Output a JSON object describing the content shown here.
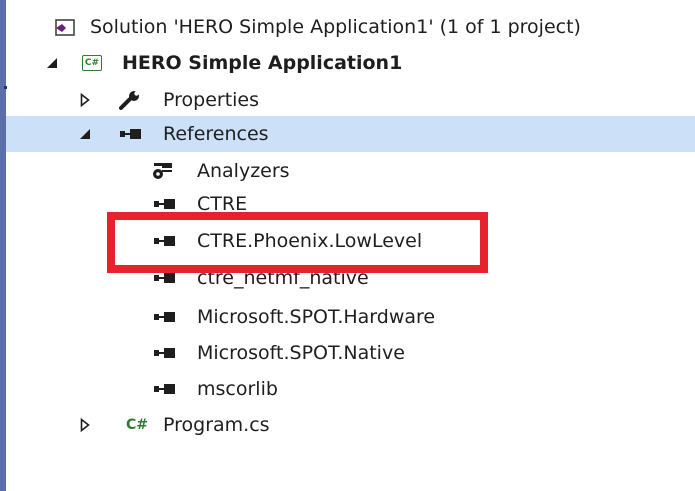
{
  "tree": {
    "solution_label": "Solution 'HERO Simple Application1' (1 of 1 project)",
    "project_label": "HERO Simple Application1",
    "project_icon_text": "C#",
    "properties_label": "Properties",
    "references_label": "References",
    "references_children": [
      "Analyzers",
      "CTRE",
      "CTRE.Phoenix.LowLevel",
      "ctre_netmf_native",
      "Microsoft.SPOT.Hardware",
      "Microsoft.SPOT.Native",
      "mscorlib"
    ],
    "program_label": "Program.cs",
    "program_icon_text": "C#"
  },
  "icons": {
    "solution": "solution-icon",
    "project": "csharp-project-icon",
    "properties": "wrench-icon",
    "references": "reference-icon",
    "analyzers": "analyzer-icon",
    "file": "csharp-file-icon"
  },
  "colors": {
    "selection": "#cce0f7",
    "highlight_box": "#e8212e",
    "csharp_green": "#2e7d32",
    "solution_purple": "#68217a"
  }
}
